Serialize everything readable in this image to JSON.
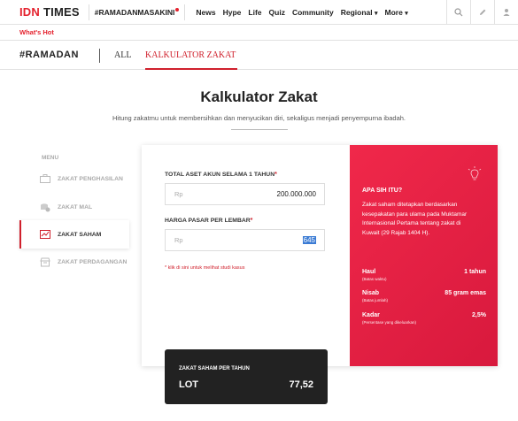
{
  "nav": {
    "logo_idn": "IDN",
    "logo_times": "TIMES",
    "hashtag": "#RAMADANMASAKINI",
    "items": [
      "News",
      "Hype",
      "Life",
      "Quiz",
      "Community",
      "Regional",
      "More"
    ],
    "icons": [
      "search-icon",
      "pencil-icon",
      "user-icon"
    ]
  },
  "hot": {
    "label": "What's Hot"
  },
  "subnav": {
    "section": "#RAMADAN",
    "tabs": [
      "ALL",
      "KALKULATOR ZAKAT"
    ],
    "active_tab": "KALKULATOR ZAKAT"
  },
  "page": {
    "title": "Kalkulator Zakat",
    "subtitle": "Hitung zakatmu untuk membersihkan dan menyucikan diri, sekaligus menjadi penyempurna ibadah."
  },
  "menu": {
    "label": "MENU",
    "items": [
      {
        "label": "ZAKAT PENGHASILAN",
        "icon": "briefcase-icon"
      },
      {
        "label": "ZAKAT MAL",
        "icon": "coins-icon"
      },
      {
        "label": "ZAKAT SAHAM",
        "icon": "chart-icon",
        "active": true
      },
      {
        "label": "ZAKAT PERDAGANGAN",
        "icon": "store-icon"
      }
    ]
  },
  "form": {
    "field1_label": "TOTAL ASET AKUN SELAMA 1 TAHUN",
    "field1_prefix": "Rp",
    "field1_value": "200.000.000",
    "field2_label": "HARGA PASAR PER LEMBAR",
    "field2_prefix": "Rp",
    "field2_value": "645",
    "required_mark": "*",
    "note": "* klik di sini untuk melihat studi kasus"
  },
  "info": {
    "heading": "APA SIH ITU?",
    "description": "Zakat saham ditetapkan berdasarkan kesepakatan para ulama pada Muktamar Internasional Pertama tentang zakat di Kuwait (29 Rajab 1404 H).",
    "rows": [
      {
        "label": "Haul",
        "sub": "(Batas waktu)",
        "value": "1 tahun"
      },
      {
        "label": "Nisab",
        "sub": "(Batas jumlah)",
        "value": "85 gram emas"
      },
      {
        "label": "Kadar",
        "sub": "(Persentase yang dikeluarkan)",
        "value": "2,5%"
      }
    ]
  },
  "result": {
    "label": "ZAKAT SAHAM PER TAHUN",
    "unit": "LOT",
    "value": "77,52"
  },
  "colors": {
    "accent": "#d0202c",
    "panel": "#e8223f",
    "dark": "#222222"
  }
}
